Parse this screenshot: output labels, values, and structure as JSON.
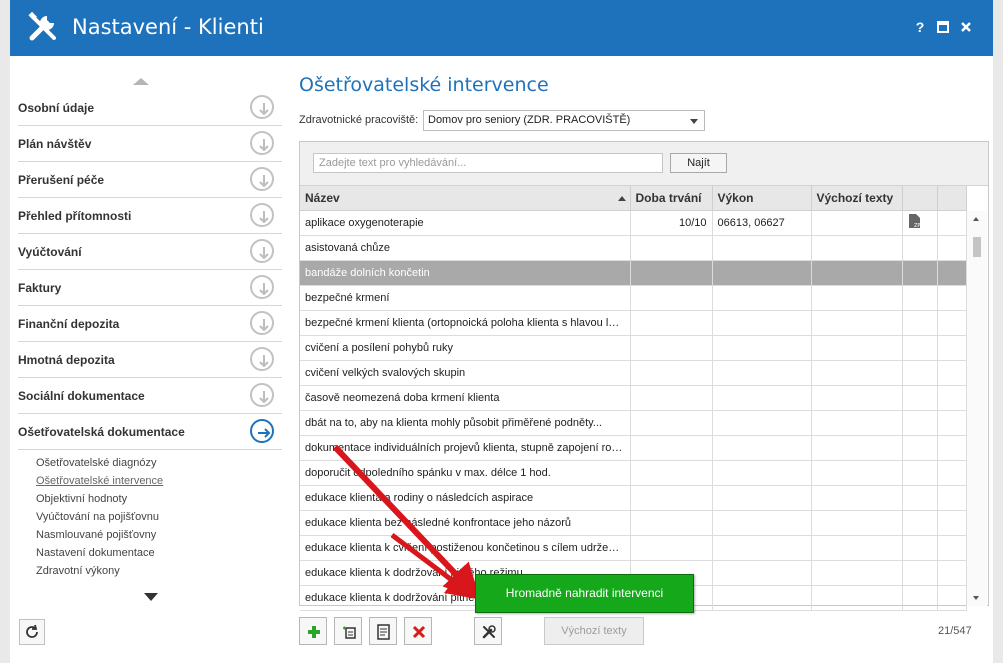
{
  "window": {
    "title": "Nastavení - Klienti",
    "help_label": "?",
    "icons": {
      "app": "wrench-screwdriver-icon",
      "maximize": "maximize-icon",
      "close": "close-icon"
    }
  },
  "sidebar": {
    "items": [
      {
        "label": "Osobní údaje"
      },
      {
        "label": "Plán návštěv"
      },
      {
        "label": "Přerušení péče"
      },
      {
        "label": "Přehled přítomnosti"
      },
      {
        "label": "Vyúčtování"
      },
      {
        "label": "Faktury"
      },
      {
        "label": "Finanční depozita"
      },
      {
        "label": "Hmotná depozita"
      },
      {
        "label": "Sociální dokumentace"
      },
      {
        "label": "Ošetřovatelská dokumentace",
        "active": true
      }
    ],
    "subitems": [
      {
        "label": "Ošetřovatelské diagnózy"
      },
      {
        "label": "Ošetřovatelské intervence",
        "active": true
      },
      {
        "label": "Objektivní hodnoty"
      },
      {
        "label": "Vyúčtování na pojišťovnu"
      },
      {
        "label": "Nasmlouvané pojišťovny"
      },
      {
        "label": "Nastavení dokumentace"
      },
      {
        "label": "Zdravotní výkony"
      }
    ]
  },
  "main": {
    "title": "Ošetřovatelské intervence",
    "workplace_label": "Zdravotnické pracoviště:",
    "workplace_value": "Domov pro seniory (ZDR. PRACOVIŠTĚ)",
    "search_placeholder": "Zadejte text pro vyhledávání...",
    "search_button": "Najít",
    "columns": [
      "Název",
      "Doba trvání",
      "Výkon",
      "Výchozí texty",
      "",
      ""
    ],
    "rows": [
      {
        "name": "aplikace oxygenoterapie",
        "duration": "10/10",
        "code": "06613, 06627",
        "defaults": "",
        "has_doc": true
      },
      {
        "name": "asistovaná chůze",
        "duration": "",
        "code": "",
        "defaults": ""
      },
      {
        "name": "bandáže dolních končetin",
        "duration": "",
        "code": "",
        "defaults": "",
        "selected": true
      },
      {
        "name": "bezpečné krmení",
        "duration": "",
        "code": "",
        "defaults": ""
      },
      {
        "name": "bezpečné krmení klienta (ortopnoická poloha klienta s hlavou leh...",
        "duration": "",
        "code": "",
        "defaults": ""
      },
      {
        "name": "cvičení a posílení pohybů ruky",
        "duration": "",
        "code": "",
        "defaults": ""
      },
      {
        "name": "cvičení velkých svalových skupin",
        "duration": "",
        "code": "",
        "defaults": ""
      },
      {
        "name": "časově neomezená doba krmení klienta",
        "duration": "",
        "code": "",
        "defaults": ""
      },
      {
        "name": "dbát na to, aby na klienta mohly působit přiměřené podněty...",
        "duration": "",
        "code": "",
        "defaults": ""
      },
      {
        "name": "dokumentace individuálních projevů klienta, stupně zapojení rodi...",
        "duration": "",
        "code": "",
        "defaults": ""
      },
      {
        "name": "doporučit odpoledního spánku v max. délce 1 hod.",
        "duration": "",
        "code": "",
        "defaults": ""
      },
      {
        "name": "edukace klienta a rodiny o následcích aspirace",
        "duration": "",
        "code": "",
        "defaults": ""
      },
      {
        "name": "edukace klienta bez následné konfrontace jeho názorů",
        "duration": "",
        "code": "",
        "defaults": ""
      },
      {
        "name": "edukace klienta k cvičení postiženou končetinou s cílem udržení j...",
        "duration": "",
        "code": "",
        "defaults": ""
      },
      {
        "name": "edukace klienta k dodržování pitného režimu",
        "duration": "",
        "code": "",
        "defaults": ""
      },
      {
        "name": "edukace klienta k dodržování pitného",
        "duration": "",
        "code": "",
        "defaults": ""
      }
    ]
  },
  "toolbar": {
    "default_texts_button": "Výchozí texty",
    "counter": "21/547",
    "icons": [
      "add-icon",
      "copy-icon",
      "edit-icon",
      "delete-icon",
      "wrench-icon",
      "refresh-icon"
    ]
  },
  "tooltip": {
    "label": "Hromadně nahradit intervenci"
  }
}
